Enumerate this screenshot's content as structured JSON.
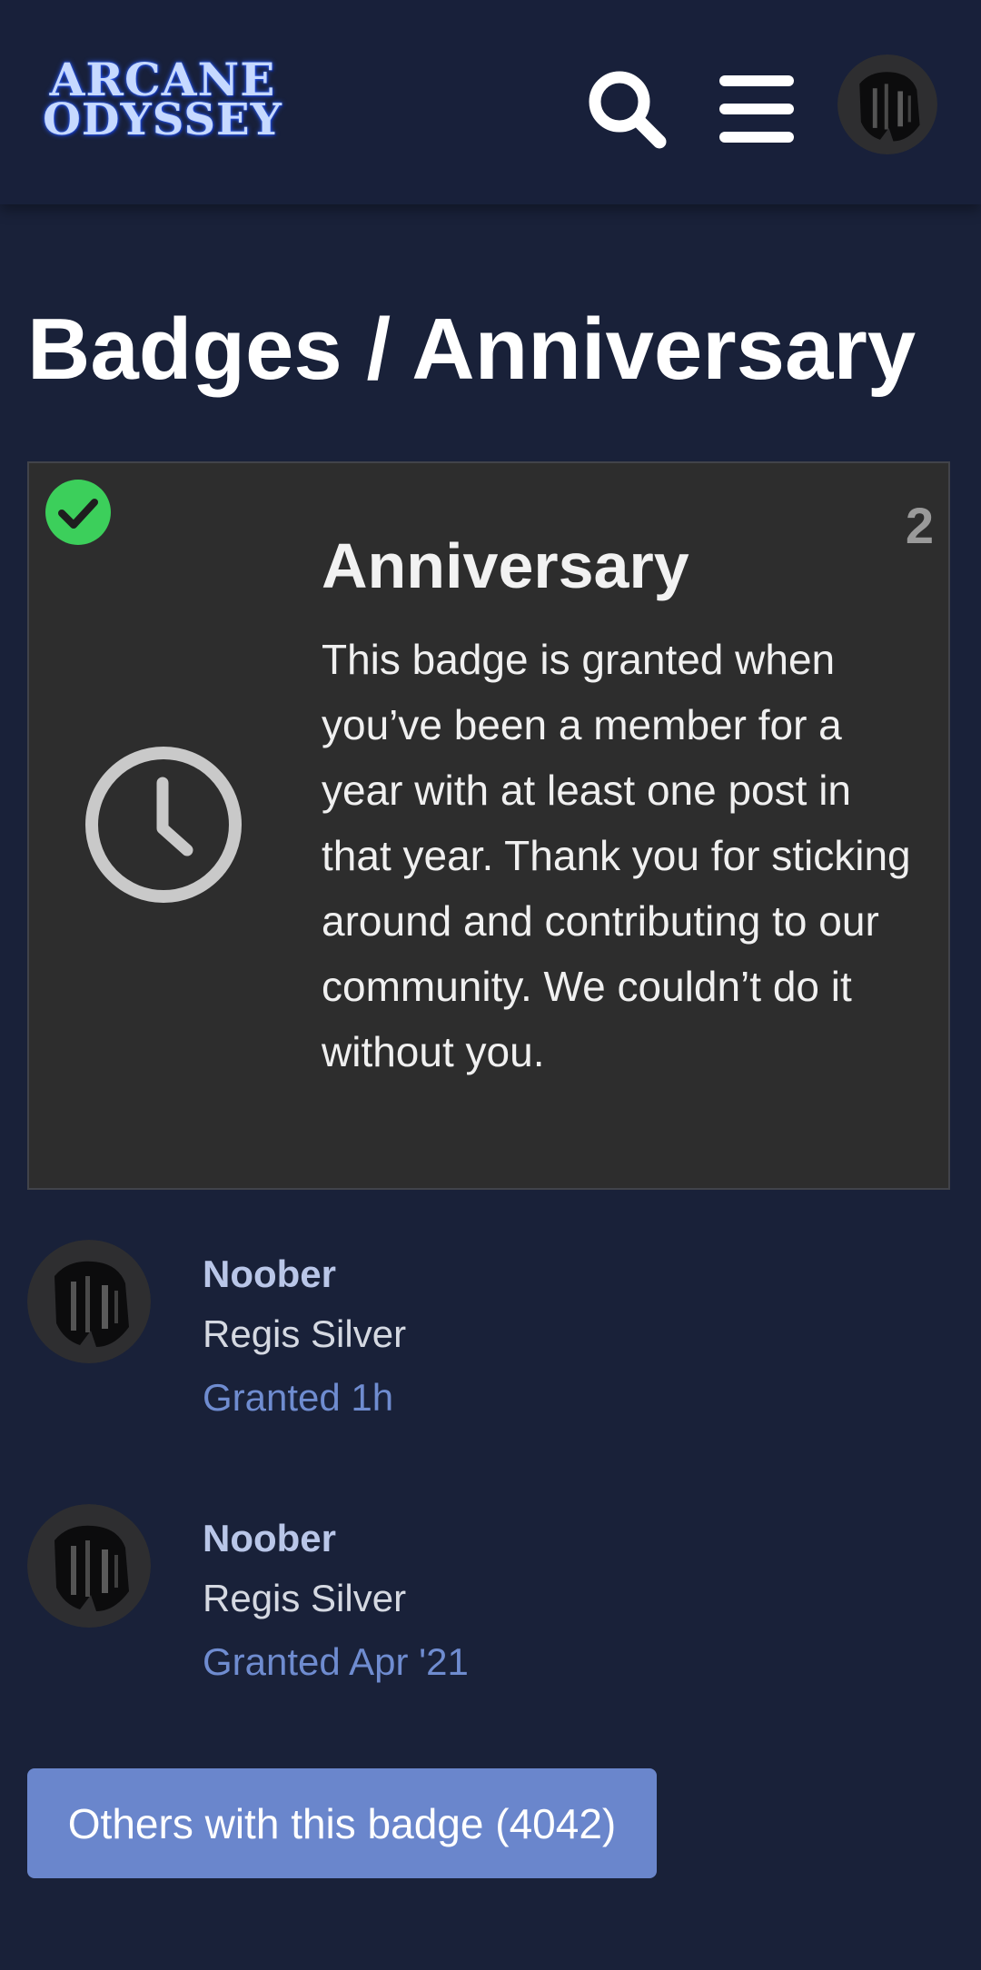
{
  "header": {
    "logo_line1": "ARCANE",
    "logo_line2": "ODYSSEY",
    "search_icon": "search-icon",
    "menu_icon": "hamburger-menu-icon",
    "avatar_icon": "user-avatar"
  },
  "page": {
    "title": "Badges / Anniversary"
  },
  "badge": {
    "granted_icon": "check-circle-icon",
    "count": "2",
    "icon": "clock-icon",
    "name": "Anniversary",
    "description": "This badge is granted when you’ve been a member for a year with at least one post in that year. Thank you for sticking around and contributing to our community. We couldn’t do it without you."
  },
  "grants": [
    {
      "username": "Noober",
      "title": "Regis Silver",
      "granted": "Granted 1h"
    },
    {
      "username": "Noober",
      "title": "Regis Silver",
      "granted": "Granted Apr '21"
    }
  ],
  "others_button": {
    "label": "Others with this badge (4042)"
  },
  "colors": {
    "background": "#192139",
    "card": "#2d2d2d",
    "check": "#3ccf5b",
    "username": "#b9c6e8",
    "granted": "#6f8cd0",
    "button": "#6a86cc"
  }
}
